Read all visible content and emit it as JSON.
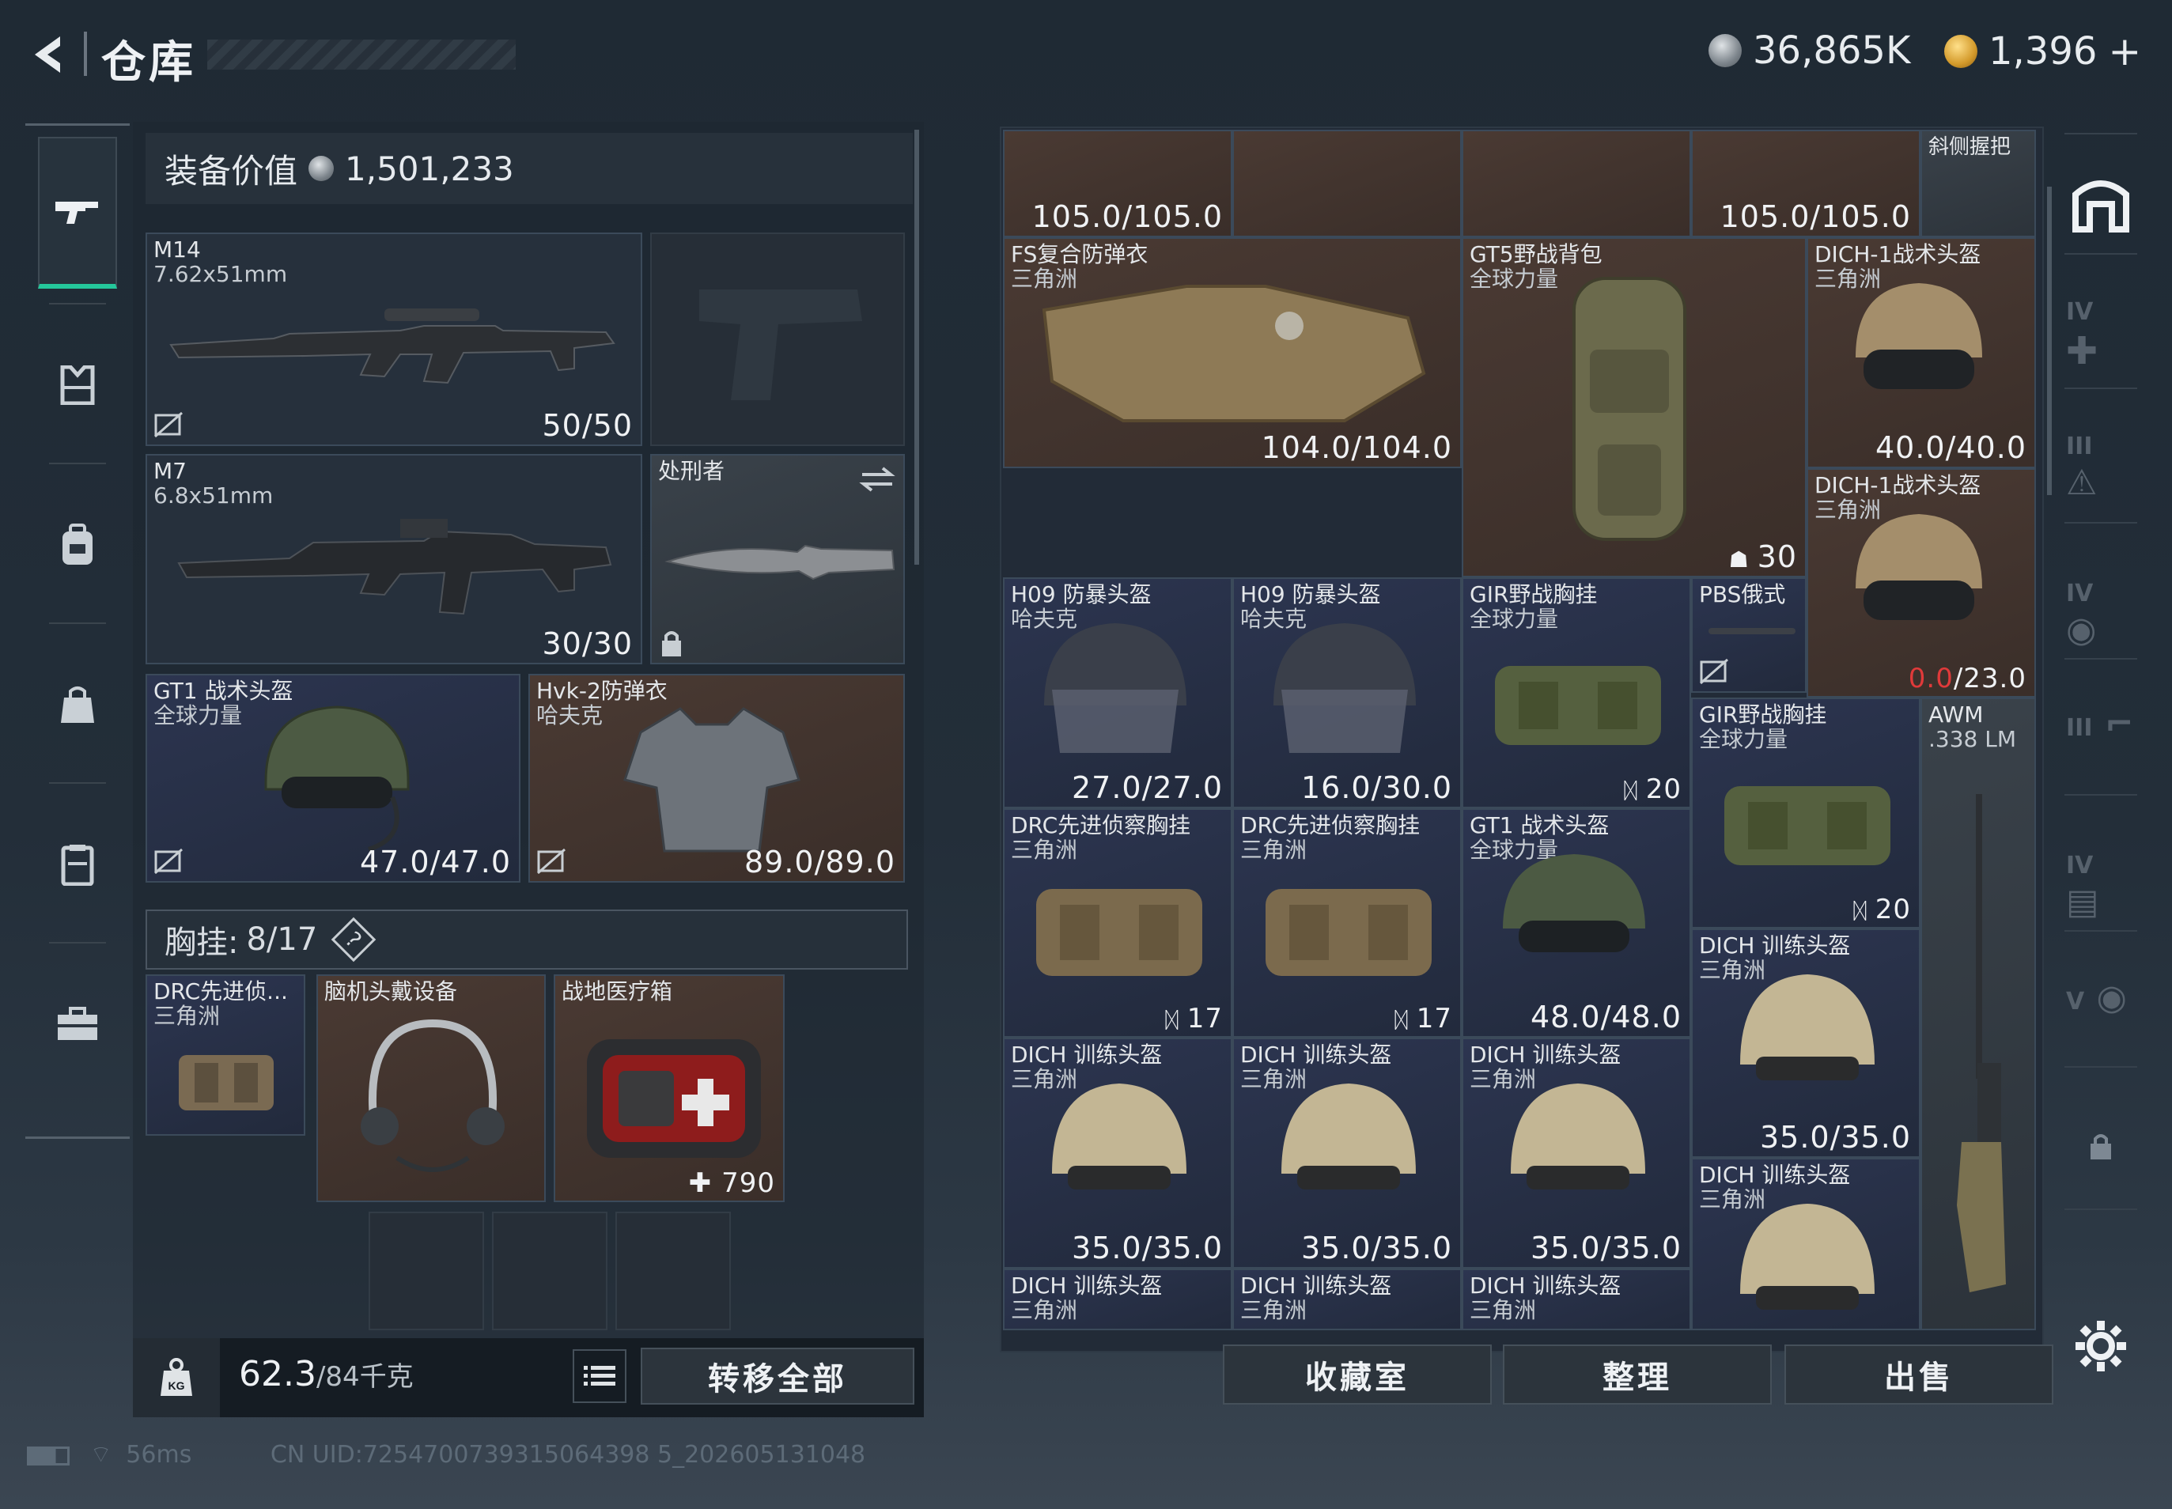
{
  "header": {
    "title": "仓库",
    "currency": [
      {
        "icon": "silver-coin-icon",
        "amount": "36,865K"
      },
      {
        "icon": "gold-coin-icon",
        "amount": "1,396"
      }
    ],
    "add_symbol": "+"
  },
  "left_nav": [
    {
      "icon": "gun-icon",
      "active": true
    },
    {
      "icon": "armor-vest-icon",
      "active": false
    },
    {
      "icon": "backpack-icon",
      "active": false
    },
    {
      "icon": "bag-icon",
      "active": false
    },
    {
      "icon": "case-icon",
      "active": false
    },
    {
      "icon": "briefcase-icon",
      "active": false
    }
  ],
  "loadout": {
    "value_label": "装备价值",
    "value": "1,501,233",
    "primary1": {
      "name": "M14",
      "caliber": "7.62x51mm",
      "ammo": "50/50"
    },
    "primary2": {
      "name": "M7",
      "caliber": "6.8x51mm",
      "ammo": "30/30"
    },
    "melee": {
      "name": "处刑者"
    },
    "helmet": {
      "name": "GT1 战术头盔",
      "faction": "全球力量",
      "durability": "47.0/47.0"
    },
    "armor": {
      "name": "Hvk-2防弹衣",
      "faction": "哈夫克",
      "durability": "89.0/89.0"
    },
    "chest_rig": {
      "label": "胸挂:",
      "value": "8/17",
      "help": "?"
    },
    "rig_items": [
      {
        "name": "DRC先进侦...",
        "faction": "三角洲"
      },
      {
        "name": "脑机头戴设备"
      },
      {
        "name": "战地医疗箱",
        "count": "790"
      }
    ]
  },
  "bottom_left": {
    "weight": "62.3",
    "weight_max": "/84千克",
    "transfer_all": "转移全部"
  },
  "stash_items": {
    "top_row": [
      {
        "value": "105.0/105.0"
      },
      {
        "value": "105.0/105.0"
      },
      {
        "name": "斜侧握把"
      }
    ],
    "fs_armor": {
      "name": "FS复合防弹衣",
      "faction": "三角洲",
      "value": "104.0/104.0"
    },
    "gt5_backpack": {
      "name": "GT5野战背包",
      "faction": "全球力量",
      "value": "30"
    },
    "dich1_a": {
      "name": "DICH-1战术头盔",
      "faction": "三角洲",
      "value": "40.0/40.0"
    },
    "dich1_b": {
      "name": "DICH-1战术头盔",
      "faction": "三角洲",
      "value_red": "0.0",
      "value_rest": "/23.0"
    },
    "h09_a": {
      "name": "H09 防暴头盔",
      "faction": "哈夫克",
      "value": "27.0/27.0"
    },
    "h09_b": {
      "name": "H09 防暴头盔",
      "faction": "哈夫克",
      "value": "16.0/30.0"
    },
    "gir_a": {
      "name": "GIR野战胸挂",
      "faction": "全球力量",
      "value": "20"
    },
    "pbs": {
      "name": "PBS俄式"
    },
    "gir_b": {
      "name": "GIR野战胸挂",
      "faction": "全球力量",
      "value": "20"
    },
    "awm": {
      "name": "AWM",
      "caliber": ".338 LM"
    },
    "drc_a": {
      "name": "DRC先进侦察胸挂",
      "faction": "三角洲",
      "value": "17"
    },
    "drc_b": {
      "name": "DRC先进侦察胸挂",
      "faction": "三角洲",
      "value": "17"
    },
    "gt1": {
      "name": "GT1 战术头盔",
      "faction": "全球力量",
      "value": "48.0/48.0"
    },
    "dich_train_tr": {
      "name": "DICH 训练头盔",
      "faction": "三角洲",
      "value": "35.0/35.0"
    },
    "dich_train_row": [
      {
        "name": "DICH 训练头盔",
        "faction": "三角洲",
        "value": "35.0/35.0"
      },
      {
        "name": "DICH 训练头盔",
        "faction": "三角洲",
        "value": "35.0/35.0"
      },
      {
        "name": "DICH 训练头盔",
        "faction": "三角洲",
        "value": "35.0/35.0"
      },
      {
        "name": "DICH 训练头盔",
        "faction": "三角洲"
      }
    ],
    "dich_train_bottom": [
      {
        "name": "DICH 训练头盔",
        "faction": "三角洲"
      },
      {
        "name": "DICH 训练头盔",
        "faction": "三角洲"
      },
      {
        "name": "DICH 训练头盔",
        "faction": "三角洲"
      }
    ]
  },
  "right_buttons": {
    "collection": "收藏室",
    "organize": "整理",
    "sell": "出售"
  },
  "right_side_tabs": [
    "IV",
    "III",
    "IV",
    "III",
    "IV",
    "V"
  ],
  "status_bar": {
    "ping": "56ms",
    "uid": "CN UID:7254700739315064398 5_202605131048"
  },
  "colors": {
    "accent": "#24c79b",
    "warning": "#e03a3a"
  }
}
